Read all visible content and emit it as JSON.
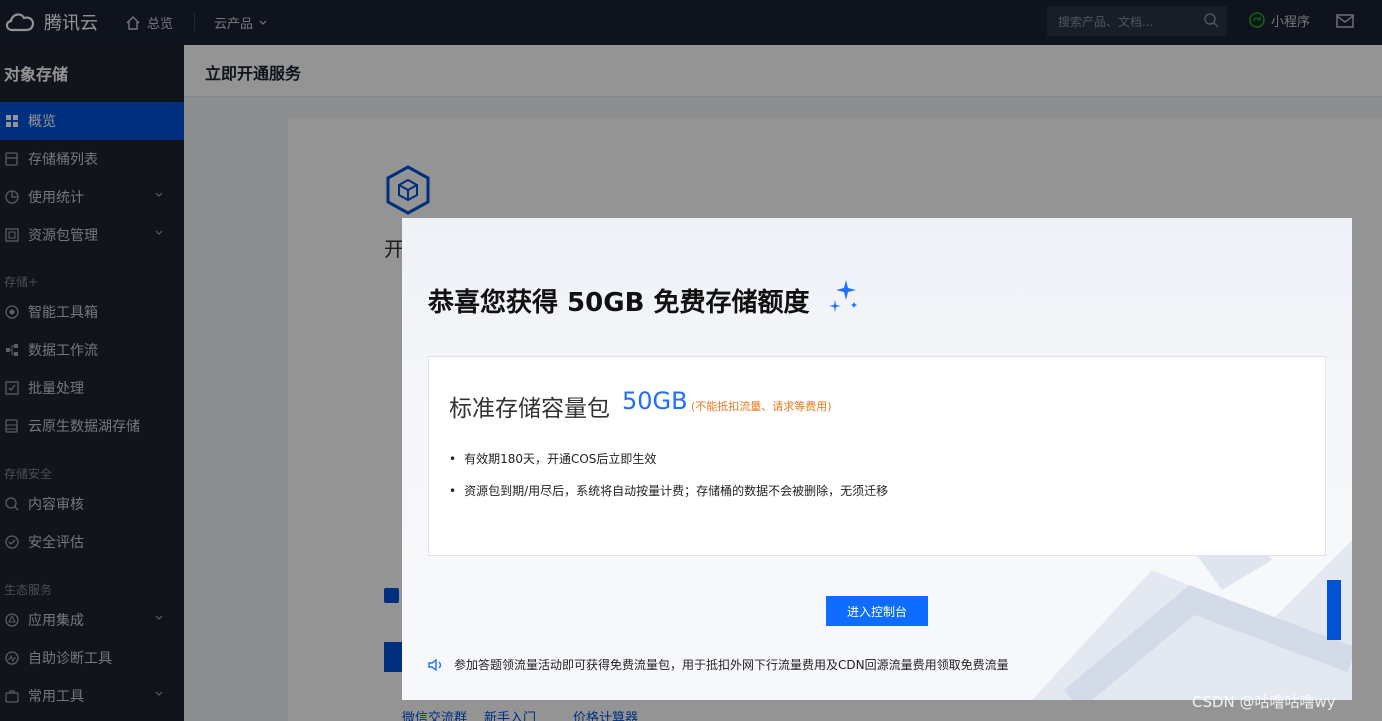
{
  "topbar": {
    "logo": "腾讯云",
    "overview": "总览",
    "products": "云产品",
    "search_placeholder": "搜索产品、文档...",
    "mini_program": "小程序"
  },
  "sidebar": {
    "title": "对象存储",
    "items": [
      {
        "label": "概览",
        "icon": "grid-icon",
        "active": true
      },
      {
        "label": "存储桶列表",
        "icon": "bucket-icon"
      },
      {
        "label": "使用统计",
        "icon": "pie-icon",
        "expand": true
      },
      {
        "label": "资源包管理",
        "icon": "package-icon",
        "expand": true
      }
    ],
    "group_storage_plus": "存储+",
    "items_plus": [
      {
        "label": "智能工具箱",
        "icon": "toolbox-icon"
      },
      {
        "label": "数据工作流",
        "icon": "workflow-icon"
      },
      {
        "label": "批量处理",
        "icon": "batch-icon"
      },
      {
        "label": "云原生数据湖存储",
        "icon": "datalake-icon"
      }
    ],
    "group_security": "存储安全",
    "items_security": [
      {
        "label": "内容审核",
        "icon": "audit-icon"
      },
      {
        "label": "安全评估",
        "icon": "security-icon"
      }
    ],
    "group_eco": "生态服务",
    "items_eco": [
      {
        "label": "应用集成",
        "icon": "integration-icon",
        "expand": true
      },
      {
        "label": "自助诊断工具",
        "icon": "diagnose-icon"
      },
      {
        "label": "常用工具",
        "icon": "tools-icon",
        "expand": true
      }
    ]
  },
  "main": {
    "title": "立即开通服务",
    "bg_heading": "开",
    "bg_links": [
      "微信交流群",
      "新手入门",
      "价格计算器"
    ]
  },
  "modal": {
    "title": "恭喜您获得 50GB 免费存储额度",
    "package_name": "标准存储容量包",
    "package_size": "50GB",
    "package_note": "(不能抵扣流量、请求等费用)",
    "bullets": [
      "有效期180天，开通COS后立即生效",
      "资源包到期/用尽后，系统将自动按量计费；存储桶的数据不会被删除，无须迁移"
    ],
    "enter_button": "进入控制台",
    "tip": "参加答题领流量活动即可获得免费流量包，用于抵扣外网下行流量费用及CDN回源流量费用领取免费流量"
  },
  "watermark": "CSDN @咕噜咕噜wy",
  "colors": {
    "accent": "#0052d9",
    "button": "#0e6cff",
    "note": "#e57a1e"
  }
}
